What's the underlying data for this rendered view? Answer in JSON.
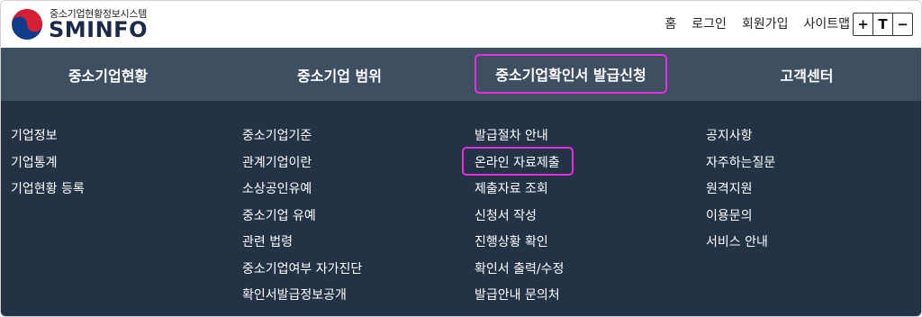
{
  "header": {
    "logo_sub": "중소기업현황정보시스템",
    "logo_main": "SMINFO",
    "util_links": [
      "홈",
      "로그인",
      "회원가입",
      "사이트맵"
    ],
    "font_controls": [
      "+",
      "T",
      "−"
    ]
  },
  "nav": {
    "items": [
      {
        "label": "중소기업현황"
      },
      {
        "label": "중소기업 범위"
      },
      {
        "label": "중소기업확인서 발급신청",
        "highlighted": true
      },
      {
        "label": "고객센터"
      }
    ],
    "highlight_color": "#e52fdc",
    "bar_color": "#3e4f62"
  },
  "mega": {
    "background": "#243246",
    "columns": [
      {
        "items": [
          "기업정보",
          "기업통계",
          "기업현황 등록"
        ]
      },
      {
        "items": [
          "중소기업기준",
          "관계기업이란",
          "소상공인유예",
          "중소기업 유예",
          "관련 법령",
          "중소기업여부 자가진단",
          "확인서발급정보공개"
        ]
      },
      {
        "items": [
          "발급절차 안내",
          "온라인 자료제출",
          "제출자료 조회",
          "신청서 작성",
          "진행상황 확인",
          "확인서 출력/수정",
          "발급안내 문의처"
        ],
        "highlighted_index": 1
      },
      {
        "items": [
          "공지사항",
          "자주하는질문",
          "원격지원",
          "이용문의",
          "서비스 안내"
        ]
      }
    ]
  }
}
